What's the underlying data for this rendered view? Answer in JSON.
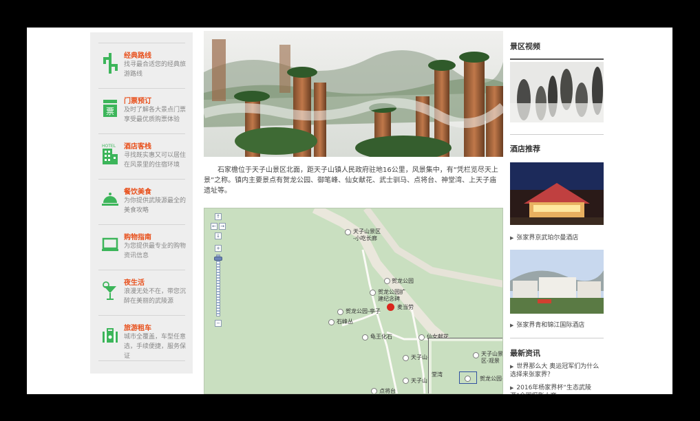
{
  "sidebar": {
    "items": [
      {
        "title": "经典路线",
        "desc": "找寻最合适您的经典旅游路线",
        "icon": "route-sign-icon"
      },
      {
        "title": "门票预订",
        "desc": "及时了解各大景点门票享受最优质购票体验",
        "icon": "ticket-icon",
        "icon_text": "票"
      },
      {
        "title": "酒店客栈",
        "desc": "寻找既实惠又可以居住在风景里的住宿环境",
        "icon": "hotel-building-icon",
        "icon_text": "HOTEL"
      },
      {
        "title": "餐饮美食",
        "desc": "为你提供武陵源最全的美食攻略",
        "icon": "food-cloche-icon"
      },
      {
        "title": "购物指南",
        "desc": "为您提供最专业的购物资讯信息",
        "icon": "shopping-laptop-icon"
      },
      {
        "title": "夜生活",
        "desc": "浪漫无处不在，带您沉醉在美丽的武陵源",
        "icon": "cocktail-icon"
      },
      {
        "title": "旅游租车",
        "desc": "城市全覆盖，车型任意选，手续便捷，服务保证",
        "icon": "car-rental-icon"
      }
    ]
  },
  "main": {
    "description": "石家檐位于天子山景区北面，距天子山镇人民政府驻地16公里，风景集中，有“凭栏览尽天上景”之称。镇内主要景点有贺龙公园、御笔峰、仙女献花、武士驯马、点将台、神堂湾、上天子庙遗址等。",
    "map": {
      "labels": [
        {
          "text": "天子山景区",
          "sub": "-小吃长廊"
        },
        {
          "text": "贺龙公园"
        },
        {
          "text": "贺龙公园扩",
          "sub": "建纪念碑"
        },
        {
          "text": "麦当劳"
        },
        {
          "text": "贺龙公园-亭子"
        },
        {
          "text": "石峰丛"
        },
        {
          "text": "龟王化石"
        },
        {
          "text": "仙女献花"
        },
        {
          "text": "天子山-观"
        },
        {
          "text": "天子山"
        },
        {
          "text": "点将台"
        }
      ],
      "minimap_labels": [
        {
          "text": "天子山景",
          "sub": "区-观景"
        },
        {
          "text": "堂湾"
        },
        {
          "text": "贺龙公园-亭"
        }
      ],
      "zoom_buttons": {
        "up": "↑",
        "left": "←",
        "right": "→",
        "down": "↓",
        "plus": "+",
        "minus": "−"
      }
    }
  },
  "right": {
    "video_heading": "景区视频",
    "hotel_heading": "酒店推荐",
    "hotels": [
      "张家界京武珀尔曼酒店",
      "张家界青和锦江国际酒店"
    ],
    "news_heading": "最新资讯",
    "news": [
      "世界那么大 奥运冠军们为什么选择来张家界？",
      "2016年杨家界杯“生态武陵源”全国摄影大赛"
    ]
  },
  "colors": {
    "accent": "#e8501c",
    "icon_green": "#3cb55a",
    "sidebar_bg": "#eeeeee",
    "map_bg": "#c9dfc0"
  }
}
